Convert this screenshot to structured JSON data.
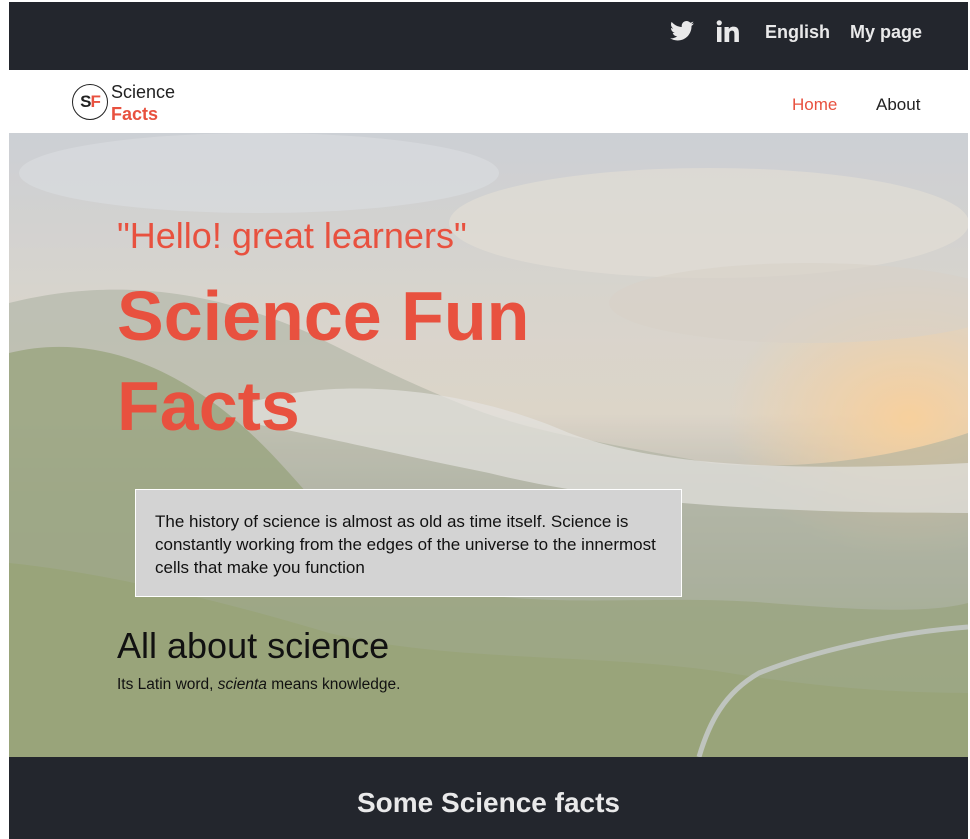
{
  "topbar": {
    "icons": [
      "twitter-icon",
      "linkedin-icon"
    ],
    "language": "English",
    "my_page": "My page",
    "bg_color": "#23262d"
  },
  "navbar": {
    "logo": {
      "mark_s": "S",
      "mark_f": "F",
      "line1": "Science",
      "line2": "Facts"
    },
    "links": [
      {
        "label": "Home"
      },
      {
        "label": "About"
      }
    ],
    "accent_color": "#e8513f"
  },
  "hero": {
    "quote": "\"Hello! great learners\"",
    "title": "Science Fun Facts",
    "info": "The history of science is almost as old as time itself. Science is constantly working from the edges of the universe to the innermost cells that make you function",
    "about_heading": "All about science",
    "about_text_before": "Its Latin word, ",
    "about_text_italic": "scienta",
    "about_text_after": " means knowledge."
  },
  "facts_section": {
    "heading": "Some Science facts"
  }
}
